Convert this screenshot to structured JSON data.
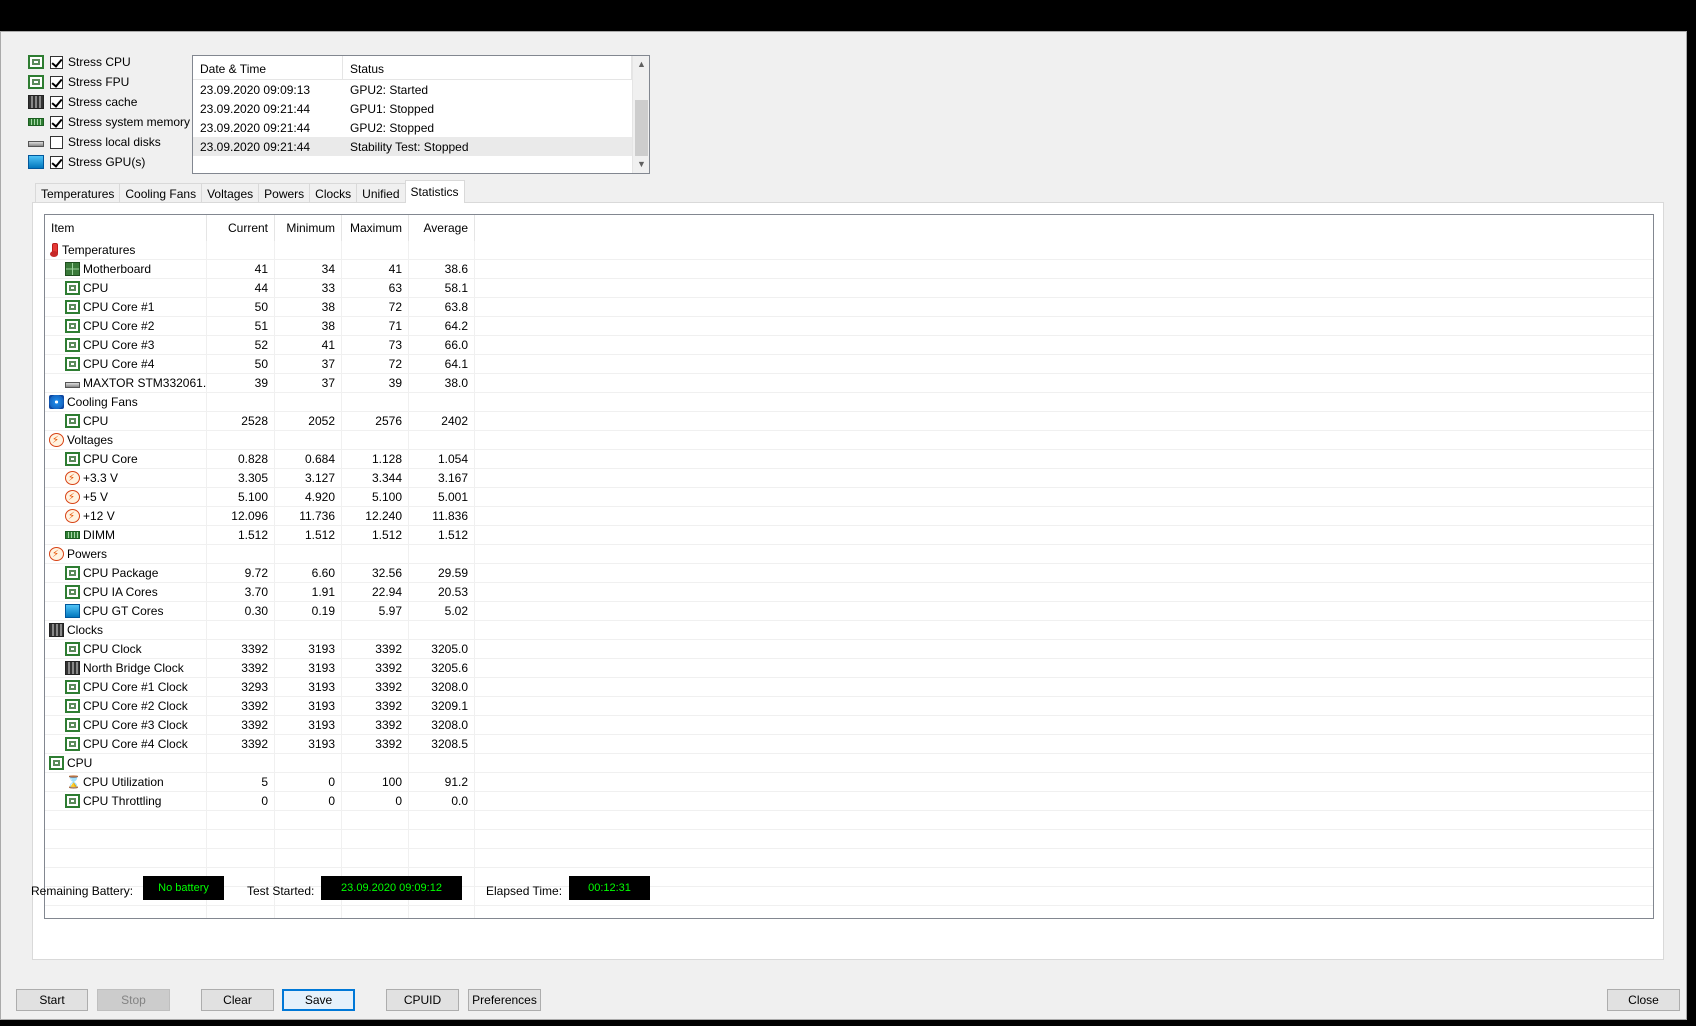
{
  "stress_options": [
    {
      "label": "Stress CPU",
      "checked": true,
      "icon": "cpu-chip-icon"
    },
    {
      "label": "Stress FPU",
      "checked": true,
      "icon": "fpu-icon"
    },
    {
      "label": "Stress cache",
      "checked": true,
      "icon": "cache-icon"
    },
    {
      "label": "Stress system memory",
      "checked": true,
      "icon": "memory-icon"
    },
    {
      "label": "Stress local disks",
      "checked": false,
      "icon": "disk-icon"
    },
    {
      "label": "Stress GPU(s)",
      "checked": true,
      "icon": "gpu-monitor-icon"
    }
  ],
  "log": {
    "headers": {
      "datetime": "Date & Time",
      "status": "Status"
    },
    "rows": [
      {
        "datetime": "23.09.2020 09:09:13",
        "status": "GPU2: Started"
      },
      {
        "datetime": "23.09.2020 09:21:44",
        "status": "GPU1: Stopped"
      },
      {
        "datetime": "23.09.2020 09:21:44",
        "status": "GPU2: Stopped"
      },
      {
        "datetime": "23.09.2020 09:21:44",
        "status": "Stability Test: Stopped"
      }
    ]
  },
  "tabs": [
    "Temperatures",
    "Cooling Fans",
    "Voltages",
    "Powers",
    "Clocks",
    "Unified",
    "Statistics"
  ],
  "active_tab": "Statistics",
  "stats": {
    "headers": {
      "item": "Item",
      "current": "Current",
      "minimum": "Minimum",
      "maximum": "Maximum",
      "average": "Average"
    },
    "rows": [
      {
        "item": "Temperatures",
        "group": true,
        "icon": "thermometer"
      },
      {
        "item": "Motherboard",
        "icon": "board",
        "current": "41",
        "minimum": "34",
        "maximum": "41",
        "average": "38.6"
      },
      {
        "item": "CPU",
        "icon": "chip",
        "current": "44",
        "minimum": "33",
        "maximum": "63",
        "average": "58.1"
      },
      {
        "item": "CPU Core #1",
        "icon": "chip",
        "current": "50",
        "minimum": "38",
        "maximum": "72",
        "average": "63.8"
      },
      {
        "item": "CPU Core #2",
        "icon": "chip",
        "current": "51",
        "minimum": "38",
        "maximum": "71",
        "average": "64.2"
      },
      {
        "item": "CPU Core #3",
        "icon": "chip",
        "current": "52",
        "minimum": "41",
        "maximum": "73",
        "average": "66.0"
      },
      {
        "item": "CPU Core #4",
        "icon": "chip",
        "current": "50",
        "minimum": "37",
        "maximum": "72",
        "average": "64.1"
      },
      {
        "item": "MAXTOR STM332061...",
        "icon": "disk",
        "current": "39",
        "minimum": "37",
        "maximum": "39",
        "average": "38.0"
      },
      {
        "item": "Cooling Fans",
        "group": true,
        "icon": "fan"
      },
      {
        "item": "CPU",
        "icon": "chip",
        "current": "2528",
        "minimum": "2052",
        "maximum": "2576",
        "average": "2402"
      },
      {
        "item": "Voltages",
        "group": true,
        "icon": "volt"
      },
      {
        "item": "CPU Core",
        "icon": "chip",
        "current": "0.828",
        "minimum": "0.684",
        "maximum": "1.128",
        "average": "1.054"
      },
      {
        "item": "+3.3 V",
        "icon": "volt",
        "current": "3.305",
        "minimum": "3.127",
        "maximum": "3.344",
        "average": "3.167"
      },
      {
        "item": "+5 V",
        "icon": "volt",
        "current": "5.100",
        "minimum": "4.920",
        "maximum": "5.100",
        "average": "5.001"
      },
      {
        "item": "+12 V",
        "icon": "volt",
        "current": "12.096",
        "minimum": "11.736",
        "maximum": "12.240",
        "average": "11.836"
      },
      {
        "item": "DIMM",
        "icon": "dimm",
        "current": "1.512",
        "minimum": "1.512",
        "maximum": "1.512",
        "average": "1.512"
      },
      {
        "item": "Powers",
        "group": true,
        "icon": "volt"
      },
      {
        "item": "CPU Package",
        "icon": "chip",
        "current": "9.72",
        "minimum": "6.60",
        "maximum": "32.56",
        "average": "29.59"
      },
      {
        "item": "CPU IA Cores",
        "icon": "chip",
        "current": "3.70",
        "minimum": "1.91",
        "maximum": "22.94",
        "average": "20.53"
      },
      {
        "item": "CPU GT Cores",
        "icon": "gpu",
        "current": "0.30",
        "minimum": "0.19",
        "maximum": "5.97",
        "average": "5.02"
      },
      {
        "item": "Clocks",
        "group": true,
        "icon": "clock"
      },
      {
        "item": "CPU Clock",
        "icon": "chip",
        "current": "3392",
        "minimum": "3193",
        "maximum": "3392",
        "average": "3205.0"
      },
      {
        "item": "North Bridge Clock",
        "icon": "clock",
        "current": "3392",
        "minimum": "3193",
        "maximum": "3392",
        "average": "3205.6"
      },
      {
        "item": "CPU Core #1 Clock",
        "icon": "chip",
        "current": "3293",
        "minimum": "3193",
        "maximum": "3392",
        "average": "3208.0"
      },
      {
        "item": "CPU Core #2 Clock",
        "icon": "chip",
        "current": "3392",
        "minimum": "3193",
        "maximum": "3392",
        "average": "3209.1"
      },
      {
        "item": "CPU Core #3 Clock",
        "icon": "chip",
        "current": "3392",
        "minimum": "3193",
        "maximum": "3392",
        "average": "3208.0"
      },
      {
        "item": "CPU Core #4 Clock",
        "icon": "chip",
        "current": "3392",
        "minimum": "3193",
        "maximum": "3392",
        "average": "3208.5"
      },
      {
        "item": "CPU",
        "group": true,
        "icon": "chip"
      },
      {
        "item": "CPU Utilization",
        "icon": "hourglass",
        "current": "5",
        "minimum": "0",
        "maximum": "100",
        "average": "91.2"
      },
      {
        "item": "CPU Throttling",
        "icon": "chip",
        "current": "0",
        "minimum": "0",
        "maximum": "0",
        "average": "0.0"
      }
    ]
  },
  "status": {
    "battery_label": "Remaining Battery:",
    "battery_value": "No battery",
    "started_label": "Test Started:",
    "started_value": "23.09.2020 09:09:12",
    "elapsed_label": "Elapsed Time:",
    "elapsed_value": "00:12:31"
  },
  "buttons": {
    "start": "Start",
    "stop": "Stop",
    "clear": "Clear",
    "save": "Save",
    "cpuid": "CPUID",
    "preferences": "Preferences",
    "close": "Close"
  }
}
